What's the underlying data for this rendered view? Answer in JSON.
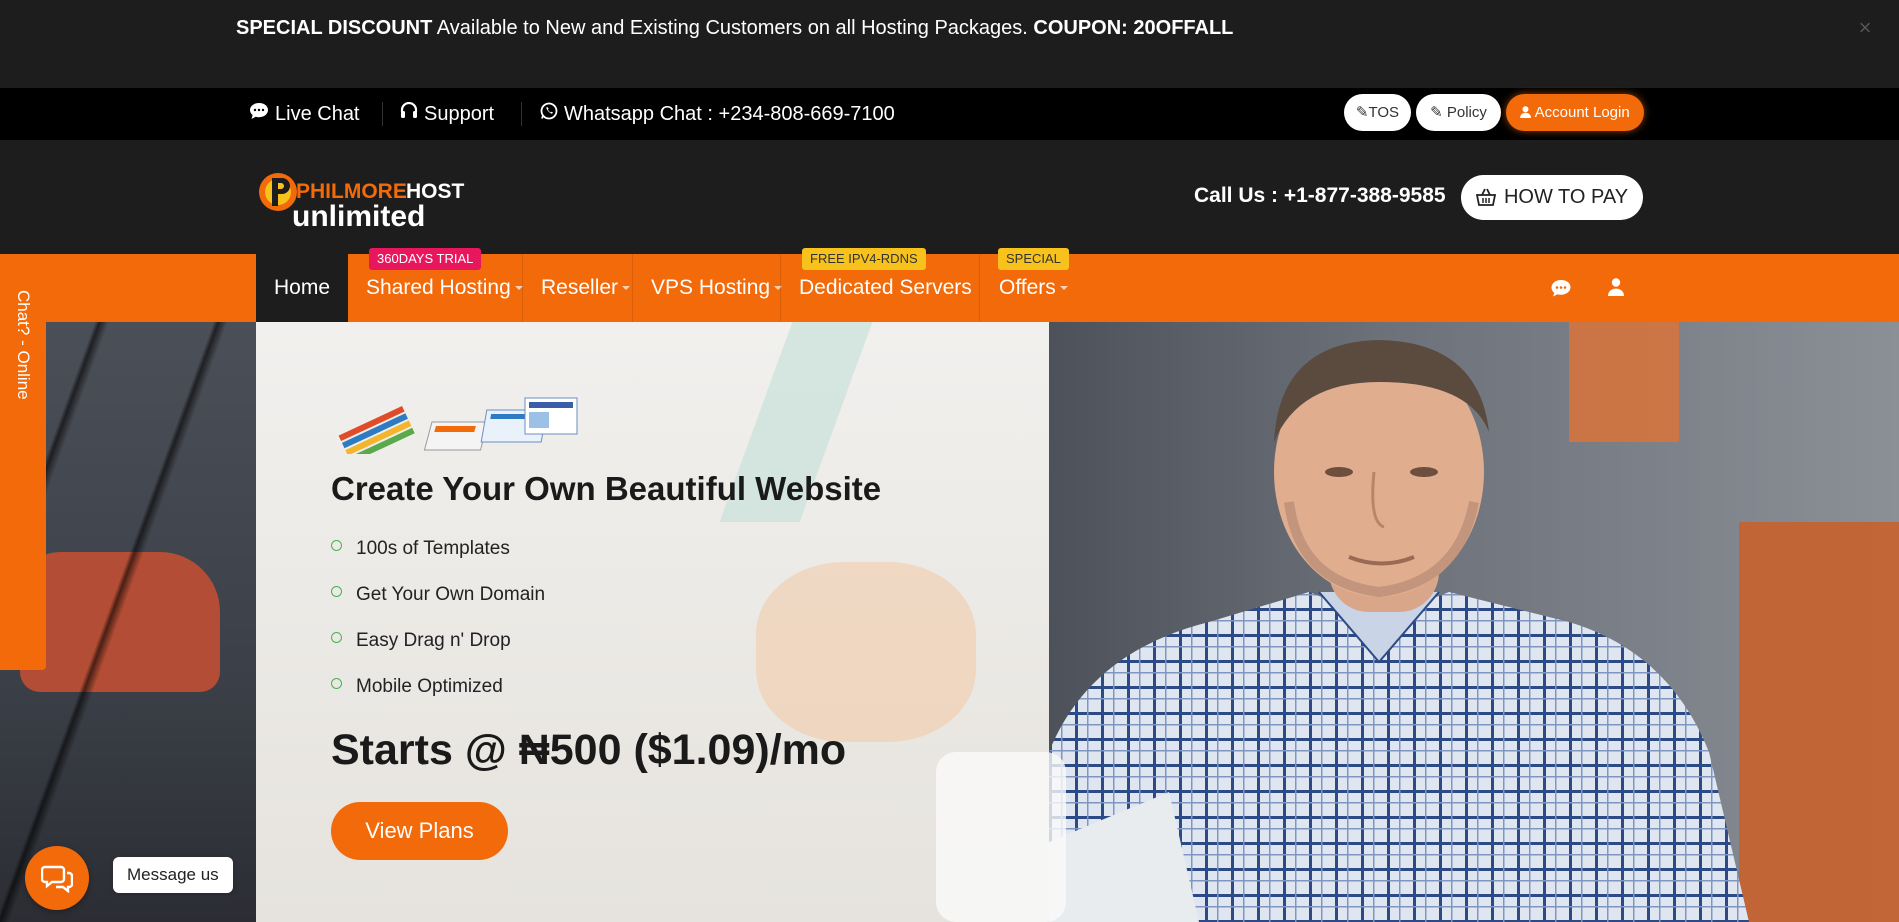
{
  "promo": {
    "bold_lead": "SPECIAL DISCOUNT",
    "text": " Available to New and Existing Customers on all Hosting Packages. ",
    "coupon": "COUPON: 20OFFALL",
    "close_glyph": "×"
  },
  "topbar": {
    "live_chat": "Live Chat",
    "support": "Support",
    "whatsapp": "Whatsapp Chat : +234-808-669-7100",
    "tos": "TOS",
    "policy": "Policy",
    "account_login": "Account Login"
  },
  "header": {
    "logo_word1": "PHILMORE",
    "logo_word2": "HOST",
    "logo_word3": "unlimited",
    "call_us": "Call Us : +1-877-388-9585",
    "how_to_pay": "HOW TO PAY"
  },
  "nav": {
    "items": [
      {
        "label": "Home"
      },
      {
        "label": "Shared Hosting",
        "badge": "360DAYS TRIAL"
      },
      {
        "label": "Reseller"
      },
      {
        "label": "VPS Hosting"
      },
      {
        "label": "Dedicated Servers",
        "badge": "FREE IPV4-RDNS"
      },
      {
        "label": "Offers",
        "badge": "SPECIAL"
      }
    ]
  },
  "hero": {
    "title": "Create Your Own Beautiful Website",
    "features": [
      "100s of Templates",
      "Get Your Own Domain",
      "Easy Drag n' Drop",
      "Mobile Optimized"
    ],
    "price": "Starts @ ₦500 ($1.09)/mo",
    "cta": "View Plans"
  },
  "side_chat": {
    "label": "Chat? - Online"
  },
  "message_us": {
    "label": "Message us"
  },
  "colors": {
    "brand_orange": "#f26a0a",
    "dark": "#1d1d1d",
    "badge_red": "#e8175d",
    "badge_yellow": "#f8c21c"
  },
  "icons": [
    "comment-icon",
    "headset-icon",
    "whatsapp-icon",
    "pencil-icon",
    "user-icon",
    "basket-icon",
    "chat-bubble-icon",
    "chevron-down-icon",
    "close-icon",
    "check-circle-icon"
  ]
}
